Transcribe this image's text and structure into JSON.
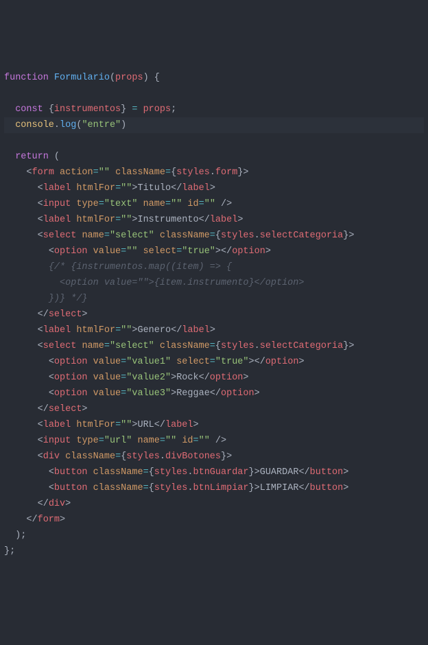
{
  "lines": [
    {
      "indent": 0,
      "tokens": [
        [
          "kw",
          "function"
        ],
        [
          "pn",
          " "
        ],
        [
          "fn",
          "Formulario"
        ],
        [
          "pn",
          "("
        ],
        [
          "vr",
          "props"
        ],
        [
          "pn",
          ") {"
        ]
      ]
    },
    {
      "indent": 0,
      "tokens": []
    },
    {
      "indent": 2,
      "tokens": [
        [
          "kw",
          "const"
        ],
        [
          "pn",
          " {"
        ],
        [
          "vr",
          "instrumentos"
        ],
        [
          "pn",
          "} "
        ],
        [
          "op",
          "="
        ],
        [
          "pn",
          " "
        ],
        [
          "vr",
          "props"
        ],
        [
          "pn",
          ";"
        ]
      ]
    },
    {
      "indent": 2,
      "hl": true,
      "tokens": [
        [
          "vr2",
          "console"
        ],
        [
          "pn",
          "."
        ],
        [
          "fn",
          "log"
        ],
        [
          "pn",
          "("
        ],
        [
          "st",
          "\"entre\""
        ],
        [
          "pn",
          ")"
        ]
      ]
    },
    {
      "indent": 0,
      "tokens": []
    },
    {
      "indent": 2,
      "tokens": [
        [
          "kw",
          "return"
        ],
        [
          "pn",
          " ("
        ]
      ]
    },
    {
      "indent": 4,
      "tokens": [
        [
          "br",
          "<"
        ],
        [
          "tag",
          "form"
        ],
        [
          "pn",
          " "
        ],
        [
          "attr",
          "action"
        ],
        [
          "op",
          "="
        ],
        [
          "st",
          "\"\""
        ],
        [
          "pn",
          " "
        ],
        [
          "attr",
          "className"
        ],
        [
          "op",
          "="
        ],
        [
          "br",
          "{"
        ],
        [
          "vr",
          "styles"
        ],
        [
          "pn",
          "."
        ],
        [
          "vr",
          "form"
        ],
        [
          "br",
          "}>"
        ]
      ]
    },
    {
      "indent": 6,
      "tokens": [
        [
          "br",
          "<"
        ],
        [
          "tag",
          "label"
        ],
        [
          "pn",
          " "
        ],
        [
          "attr",
          "htmlFor"
        ],
        [
          "op",
          "="
        ],
        [
          "st",
          "\"\""
        ],
        [
          "br",
          ">"
        ],
        [
          "txt",
          "Titulo"
        ],
        [
          "br",
          "</"
        ],
        [
          "tag",
          "label"
        ],
        [
          "br",
          ">"
        ]
      ]
    },
    {
      "indent": 6,
      "tokens": [
        [
          "br",
          "<"
        ],
        [
          "tag",
          "input"
        ],
        [
          "pn",
          " "
        ],
        [
          "attr",
          "type"
        ],
        [
          "op",
          "="
        ],
        [
          "st",
          "\"text\""
        ],
        [
          "pn",
          " "
        ],
        [
          "attr",
          "name"
        ],
        [
          "op",
          "="
        ],
        [
          "st",
          "\"\""
        ],
        [
          "pn",
          " "
        ],
        [
          "attr",
          "id"
        ],
        [
          "op",
          "="
        ],
        [
          "st",
          "\"\""
        ],
        [
          "br",
          " />"
        ]
      ]
    },
    {
      "indent": 6,
      "tokens": [
        [
          "br",
          "<"
        ],
        [
          "tag",
          "label"
        ],
        [
          "pn",
          " "
        ],
        [
          "attr",
          "htmlFor"
        ],
        [
          "op",
          "="
        ],
        [
          "st",
          "\"\""
        ],
        [
          "br",
          ">"
        ],
        [
          "txt",
          "Instrumento"
        ],
        [
          "br",
          "</"
        ],
        [
          "tag",
          "label"
        ],
        [
          "br",
          ">"
        ]
      ]
    },
    {
      "indent": 6,
      "tokens": [
        [
          "br",
          "<"
        ],
        [
          "tag",
          "select"
        ],
        [
          "pn",
          " "
        ],
        [
          "attr",
          "name"
        ],
        [
          "op",
          "="
        ],
        [
          "st",
          "\"select\""
        ],
        [
          "pn",
          " "
        ],
        [
          "attr",
          "className"
        ],
        [
          "op",
          "="
        ],
        [
          "br",
          "{"
        ],
        [
          "vr",
          "styles"
        ],
        [
          "pn",
          "."
        ],
        [
          "vr",
          "selectCategoria"
        ],
        [
          "br",
          "}>"
        ]
      ]
    },
    {
      "indent": 8,
      "tokens": [
        [
          "br",
          "<"
        ],
        [
          "tag",
          "option"
        ],
        [
          "pn",
          " "
        ],
        [
          "attr",
          "value"
        ],
        [
          "op",
          "="
        ],
        [
          "st",
          "\"\""
        ],
        [
          "pn",
          " "
        ],
        [
          "attr",
          "select"
        ],
        [
          "op",
          "="
        ],
        [
          "st",
          "\"true\""
        ],
        [
          "br",
          "></"
        ],
        [
          "tag",
          "option"
        ],
        [
          "br",
          ">"
        ]
      ]
    },
    {
      "indent": 8,
      "tokens": [
        [
          "cm",
          "{/* {instrumentos.map((item) => {"
        ]
      ]
    },
    {
      "indent": 10,
      "tokens": [
        [
          "cm",
          "<option value=\"\">{item.instrumento}</option>"
        ]
      ]
    },
    {
      "indent": 8,
      "tokens": [
        [
          "cm",
          "})} */}"
        ]
      ]
    },
    {
      "indent": 6,
      "tokens": [
        [
          "br",
          "</"
        ],
        [
          "tag",
          "select"
        ],
        [
          "br",
          ">"
        ]
      ]
    },
    {
      "indent": 6,
      "tokens": [
        [
          "br",
          "<"
        ],
        [
          "tag",
          "label"
        ],
        [
          "pn",
          " "
        ],
        [
          "attr",
          "htmlFor"
        ],
        [
          "op",
          "="
        ],
        [
          "st",
          "\"\""
        ],
        [
          "br",
          ">"
        ],
        [
          "txt",
          "Genero"
        ],
        [
          "br",
          "</"
        ],
        [
          "tag",
          "label"
        ],
        [
          "br",
          ">"
        ]
      ]
    },
    {
      "indent": 6,
      "tokens": [
        [
          "br",
          "<"
        ],
        [
          "tag",
          "select"
        ],
        [
          "pn",
          " "
        ],
        [
          "attr",
          "name"
        ],
        [
          "op",
          "="
        ],
        [
          "st",
          "\"select\""
        ],
        [
          "pn",
          " "
        ],
        [
          "attr",
          "className"
        ],
        [
          "op",
          "="
        ],
        [
          "br",
          "{"
        ],
        [
          "vr",
          "styles"
        ],
        [
          "pn",
          "."
        ],
        [
          "vr",
          "selectCategoria"
        ],
        [
          "br",
          "}>"
        ]
      ]
    },
    {
      "indent": 8,
      "tokens": [
        [
          "br",
          "<"
        ],
        [
          "tag",
          "option"
        ],
        [
          "pn",
          " "
        ],
        [
          "attr",
          "value"
        ],
        [
          "op",
          "="
        ],
        [
          "st",
          "\"value1\""
        ],
        [
          "pn",
          " "
        ],
        [
          "attr",
          "select"
        ],
        [
          "op",
          "="
        ],
        [
          "st",
          "\"true\""
        ],
        [
          "br",
          "></"
        ],
        [
          "tag",
          "option"
        ],
        [
          "br",
          ">"
        ]
      ]
    },
    {
      "indent": 8,
      "tokens": [
        [
          "br",
          "<"
        ],
        [
          "tag",
          "option"
        ],
        [
          "pn",
          " "
        ],
        [
          "attr",
          "value"
        ],
        [
          "op",
          "="
        ],
        [
          "st",
          "\"value2\""
        ],
        [
          "br",
          ">"
        ],
        [
          "txt",
          "Rock"
        ],
        [
          "br",
          "</"
        ],
        [
          "tag",
          "option"
        ],
        [
          "br",
          ">"
        ]
      ]
    },
    {
      "indent": 8,
      "tokens": [
        [
          "br",
          "<"
        ],
        [
          "tag",
          "option"
        ],
        [
          "pn",
          " "
        ],
        [
          "attr",
          "value"
        ],
        [
          "op",
          "="
        ],
        [
          "st",
          "\"value3\""
        ],
        [
          "br",
          ">"
        ],
        [
          "txt",
          "Reggae"
        ],
        [
          "br",
          "</"
        ],
        [
          "tag",
          "option"
        ],
        [
          "br",
          ">"
        ]
      ]
    },
    {
      "indent": 6,
      "tokens": [
        [
          "br",
          "</"
        ],
        [
          "tag",
          "select"
        ],
        [
          "br",
          ">"
        ]
      ]
    },
    {
      "indent": 6,
      "tokens": [
        [
          "br",
          "<"
        ],
        [
          "tag",
          "label"
        ],
        [
          "pn",
          " "
        ],
        [
          "attr",
          "htmlFor"
        ],
        [
          "op",
          "="
        ],
        [
          "st",
          "\"\""
        ],
        [
          "br",
          ">"
        ],
        [
          "txt",
          "URL"
        ],
        [
          "br",
          "</"
        ],
        [
          "tag",
          "label"
        ],
        [
          "br",
          ">"
        ]
      ]
    },
    {
      "indent": 6,
      "tokens": [
        [
          "br",
          "<"
        ],
        [
          "tag",
          "input"
        ],
        [
          "pn",
          " "
        ],
        [
          "attr",
          "type"
        ],
        [
          "op",
          "="
        ],
        [
          "st",
          "\"url\""
        ],
        [
          "pn",
          " "
        ],
        [
          "attr",
          "name"
        ],
        [
          "op",
          "="
        ],
        [
          "st",
          "\"\""
        ],
        [
          "pn",
          " "
        ],
        [
          "attr",
          "id"
        ],
        [
          "op",
          "="
        ],
        [
          "st",
          "\"\""
        ],
        [
          "br",
          " />"
        ]
      ]
    },
    {
      "indent": 6,
      "tokens": [
        [
          "br",
          "<"
        ],
        [
          "tag",
          "div"
        ],
        [
          "pn",
          " "
        ],
        [
          "attr",
          "className"
        ],
        [
          "op",
          "="
        ],
        [
          "br",
          "{"
        ],
        [
          "vr",
          "styles"
        ],
        [
          "pn",
          "."
        ],
        [
          "vr",
          "divBotones"
        ],
        [
          "br",
          "}>"
        ]
      ]
    },
    {
      "indent": 8,
      "tokens": [
        [
          "br",
          "<"
        ],
        [
          "tag",
          "button"
        ],
        [
          "pn",
          " "
        ],
        [
          "attr",
          "className"
        ],
        [
          "op",
          "="
        ],
        [
          "br",
          "{"
        ],
        [
          "vr",
          "styles"
        ],
        [
          "pn",
          "."
        ],
        [
          "vr",
          "btnGuardar"
        ],
        [
          "br",
          "}>"
        ],
        [
          "txt",
          "GUARDAR"
        ],
        [
          "br",
          "</"
        ],
        [
          "tag",
          "button"
        ],
        [
          "br",
          ">"
        ]
      ]
    },
    {
      "indent": 8,
      "tokens": [
        [
          "br",
          "<"
        ],
        [
          "tag",
          "button"
        ],
        [
          "pn",
          " "
        ],
        [
          "attr",
          "className"
        ],
        [
          "op",
          "="
        ],
        [
          "br",
          "{"
        ],
        [
          "vr",
          "styles"
        ],
        [
          "pn",
          "."
        ],
        [
          "vr",
          "btnLimpiar"
        ],
        [
          "br",
          "}>"
        ],
        [
          "txt",
          "LIMPIAR"
        ],
        [
          "br",
          "</"
        ],
        [
          "tag",
          "button"
        ],
        [
          "br",
          ">"
        ]
      ]
    },
    {
      "indent": 6,
      "tokens": [
        [
          "br",
          "</"
        ],
        [
          "tag",
          "div"
        ],
        [
          "br",
          ">"
        ]
      ]
    },
    {
      "indent": 4,
      "tokens": [
        [
          "br",
          "</"
        ],
        [
          "tag",
          "form"
        ],
        [
          "br",
          ">"
        ]
      ]
    },
    {
      "indent": 2,
      "tokens": [
        [
          "pn",
          ");"
        ]
      ]
    },
    {
      "indent": 0,
      "tokens": [
        [
          "pn",
          "};"
        ]
      ]
    }
  ]
}
